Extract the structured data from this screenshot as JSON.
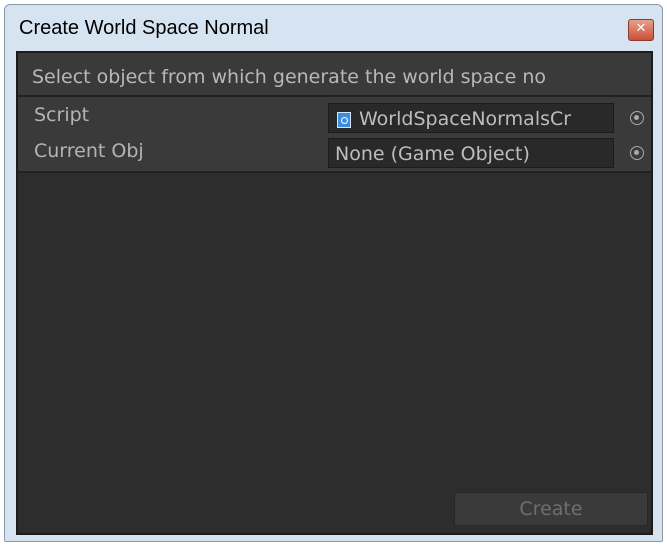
{
  "window": {
    "title": "Create World Space Normal",
    "close_glyph": "✕"
  },
  "help_text": "Select object from which generate the world space no",
  "fields": [
    {
      "label": "Script",
      "value": "WorldSpaceNormalsCr",
      "icon": "script-icon"
    },
    {
      "label": "Current Obj",
      "value": "None (Game Object)",
      "icon": "none"
    }
  ],
  "actions": {
    "create_label": "Create",
    "create_enabled": false
  },
  "colors": {
    "panel_bg": "#2d2d2d",
    "row_bg": "#3a3a3a",
    "field_bg": "#292929",
    "text": "#b8b8b8",
    "disabled_text": "#6f6f6f",
    "chrome": "#d6e3f1",
    "close_red": "#c9503a"
  }
}
